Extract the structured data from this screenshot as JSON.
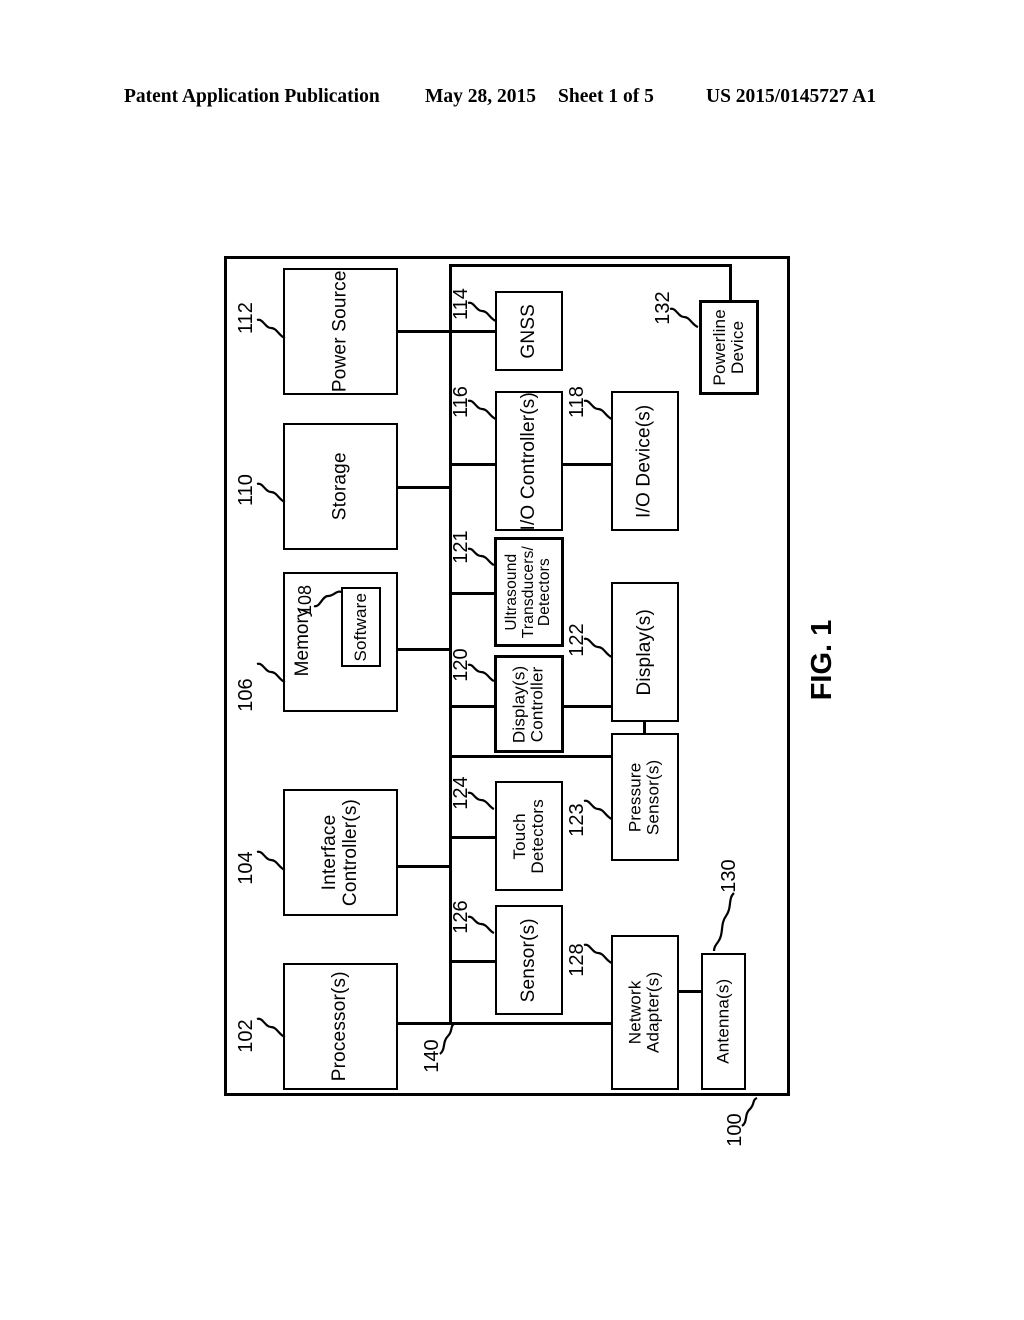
{
  "header": {
    "publication": "Patent Application Publication",
    "date": "May 28, 2015",
    "sheet": "Sheet 1 of 5",
    "number": "US 2015/0145727 A1"
  },
  "figure": {
    "caption": "FIG. 1",
    "system_ref": "100",
    "bus_ref": "140",
    "blocks": [
      {
        "ref": "102",
        "label": "Processor(s)"
      },
      {
        "ref": "104",
        "label": "Interface\nController(s)"
      },
      {
        "ref": "106",
        "label": "Memory"
      },
      {
        "ref": "108",
        "label": "Software"
      },
      {
        "ref": "110",
        "label": "Storage"
      },
      {
        "ref": "112",
        "label": "Power Source"
      },
      {
        "ref": "114",
        "label": "GNSS"
      },
      {
        "ref": "116",
        "label": "I/O Controller(s)"
      },
      {
        "ref": "118",
        "label": "I/O Device(s)"
      },
      {
        "ref": "120",
        "label": "Display(s)\nController"
      },
      {
        "ref": "121",
        "label": "Ultrasound\nTransducers/\nDetectors"
      },
      {
        "ref": "122",
        "label": "Display(s)"
      },
      {
        "ref": "123",
        "label": "Pressure\nSensor(s)"
      },
      {
        "ref": "124",
        "label": "Touch\nDetectors"
      },
      {
        "ref": "126",
        "label": "Sensor(s)"
      },
      {
        "ref": "128",
        "label": "Network\nAdapter(s)"
      },
      {
        "ref": "130",
        "label": "Antenna(s)"
      },
      {
        "ref": "132",
        "label": "Powerline\nDevice"
      }
    ],
    "labels": {
      "processors": "Processor(s)",
      "interface_controllers_l1": "Interface",
      "interface_controllers_l2": "Controller(s)",
      "memory": "Memory",
      "software": "Software",
      "storage": "Storage",
      "power_source": "Power Source",
      "gnss": "GNSS",
      "io_controllers": "I/O Controller(s)",
      "io_devices": "I/O Device(s)",
      "display_controller_l1": "Display(s)",
      "display_controller_l2": "Controller",
      "ultrasound_l1": "Ultrasound",
      "ultrasound_l2": "Transducers/",
      "ultrasound_l3": "Detectors",
      "displays": "Display(s)",
      "pressure_sensors_l1": "Pressure",
      "pressure_sensors_l2": "Sensor(s)",
      "touch_detectors_l1": "Touch",
      "touch_detectors_l2": "Detectors",
      "sensors": "Sensor(s)",
      "network_adapters_l1": "Network",
      "network_adapters_l2": "Adapter(s)",
      "antennas": "Antenna(s)",
      "powerline_l1": "Powerline",
      "powerline_l2": "Device"
    },
    "refs": {
      "r100": "100",
      "r102": "102",
      "r104": "104",
      "r106": "106",
      "r108": "108",
      "r110": "110",
      "r112": "112",
      "r114": "114",
      "r116": "116",
      "r118": "118",
      "r120": "120",
      "r121": "121",
      "r122": "122",
      "r123": "123",
      "r124": "124",
      "r126": "126",
      "r128": "128",
      "r130": "130",
      "r132": "132",
      "r140": "140"
    }
  },
  "colors": {
    "ink": "#000000",
    "paper": "#ffffff"
  }
}
